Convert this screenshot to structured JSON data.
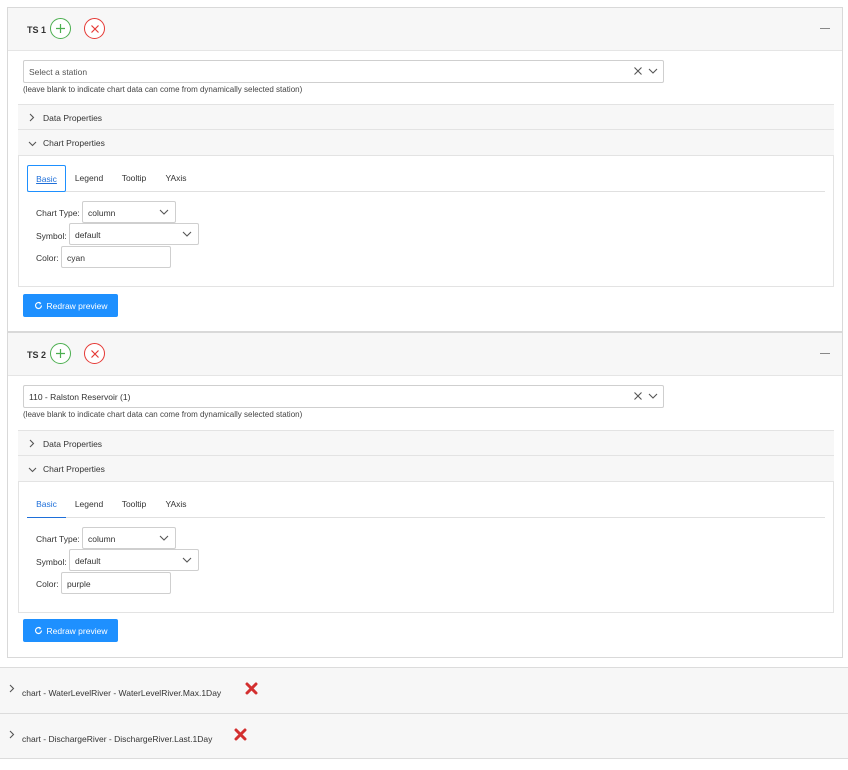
{
  "ts_panels": [
    {
      "title": "TS 1",
      "station": {
        "placeholder": "Select a station",
        "value": ""
      },
      "hint": "(leave blank to indicate chart data can come from dynamically selected station)",
      "data_properties_label": "Data Properties",
      "chart_properties_label": "Chart Properties",
      "tabs": [
        "Basic",
        "Legend",
        "Tooltip",
        "YAxis"
      ],
      "active_tab": "Basic",
      "chart_type_label": "Chart Type:",
      "chart_type_value": "column",
      "symbol_label": "Symbol:",
      "symbol_value": "default",
      "color_label": "Color:",
      "color_value": "cyan",
      "redraw_label": "Redraw preview"
    },
    {
      "title": "TS 2",
      "station": {
        "placeholder": "Select a station",
        "value": "110 - Ralston Reservoir (1)"
      },
      "hint": "(leave blank to indicate chart data can come from dynamically selected station)",
      "data_properties_label": "Data Properties",
      "chart_properties_label": "Chart Properties",
      "tabs": [
        "Basic",
        "Legend",
        "Tooltip",
        "YAxis"
      ],
      "active_tab": "Basic",
      "chart_type_label": "Chart Type:",
      "chart_type_value": "column",
      "symbol_label": "Symbol:",
      "symbol_value": "default",
      "color_label": "Color:",
      "color_value": "purple",
      "redraw_label": "Redraw preview"
    }
  ],
  "charts": [
    {
      "label": "chart - WaterLevelRiver - WaterLevelRiver.Max.1Day"
    },
    {
      "label": "chart - DischargeRiver - DischargeRiver.Last.1Day"
    }
  ],
  "colors": {
    "accent": "#1e90ff",
    "add": "#4caf50",
    "remove": "#e53935",
    "delete_x": "#d32f2f"
  },
  "icons": {
    "add": "plus-circle-icon",
    "remove": "x-circle-icon",
    "collapse": "minus-icon",
    "expand": "chevron-right-icon",
    "expanded": "chevron-down-icon",
    "redraw": "refresh-icon",
    "delete": "delete-x-icon"
  }
}
